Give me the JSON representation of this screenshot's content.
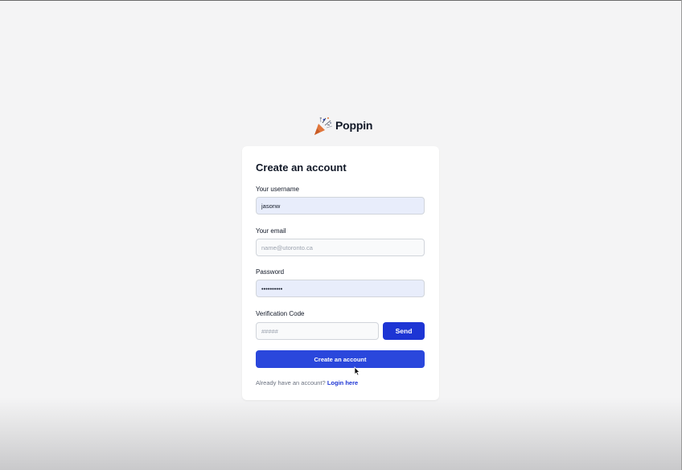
{
  "brand": {
    "name": "Poppin",
    "icon": "party-popper-icon"
  },
  "form": {
    "title": "Create an account",
    "username": {
      "label": "Your username",
      "value": "jasonw"
    },
    "email": {
      "label": "Your email",
      "value": "",
      "placeholder": "name@utoronto.ca"
    },
    "password": {
      "label": "Password",
      "value": "••••••••••"
    },
    "verification": {
      "label": "Verification Code",
      "value": "",
      "placeholder": "#####",
      "send_label": "Send"
    },
    "submit_label": "Create an account",
    "footer": {
      "prompt": "Already have an account?",
      "link_label": "Login here"
    }
  },
  "colors": {
    "primary": "#2a47dc",
    "primary_dark": "#1d35d4",
    "autofill_bg": "#e8edfb",
    "page_bg": "#f4f4f5"
  }
}
